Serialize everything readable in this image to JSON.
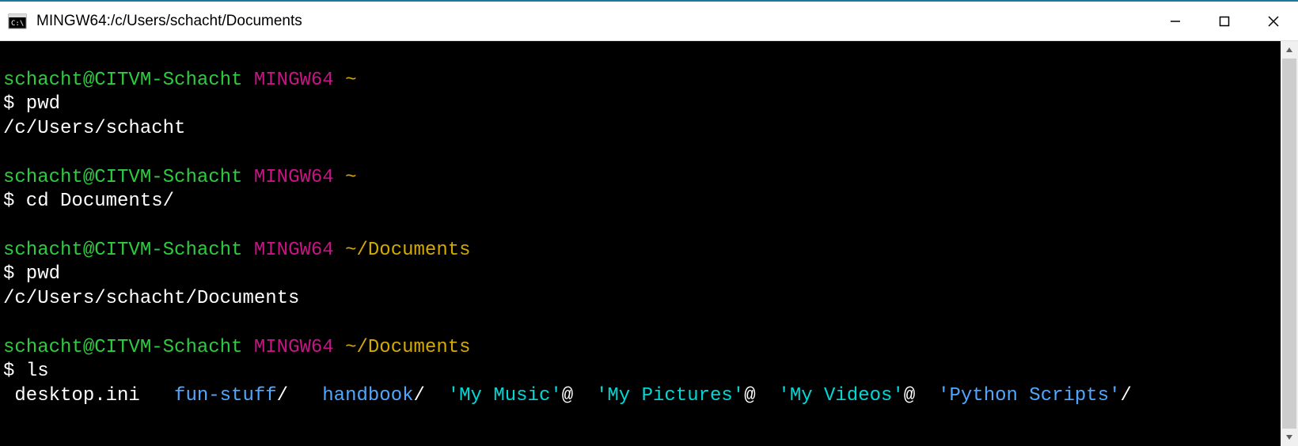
{
  "window": {
    "title": "MINGW64:/c/Users/schacht/Documents"
  },
  "terminal": {
    "blocks": [
      {
        "user_host": "schacht@CITVM-Schacht",
        "env": "MINGW64",
        "path": "~",
        "prompt": "$",
        "command": "pwd",
        "output": [
          {
            "segments": [
              {
                "text": "/c/Users/schacht",
                "cls": "white-txt"
              }
            ]
          }
        ]
      },
      {
        "user_host": "schacht@CITVM-Schacht",
        "env": "MINGW64",
        "path": "~",
        "prompt": "$",
        "command": "cd Documents/",
        "output": []
      },
      {
        "user_host": "schacht@CITVM-Schacht",
        "env": "MINGW64",
        "path": "~/Documents",
        "prompt": "$",
        "command": "pwd",
        "output": [
          {
            "segments": [
              {
                "text": "/c/Users/schacht/Documents",
                "cls": "white-txt"
              }
            ]
          }
        ]
      },
      {
        "user_host": "schacht@CITVM-Schacht",
        "env": "MINGW64",
        "path": "~/Documents",
        "prompt": "$",
        "command": "ls",
        "output": [
          {
            "segments": [
              {
                "text": " desktop.ini   ",
                "cls": "white-txt"
              },
              {
                "text": "fun-stuff",
                "cls": "blue-txt"
              },
              {
                "text": "/   ",
                "cls": "white-txt"
              },
              {
                "text": "handbook",
                "cls": "blue-txt"
              },
              {
                "text": "/  ",
                "cls": "white-txt"
              },
              {
                "text": "'My Music'",
                "cls": "cyan-txt"
              },
              {
                "text": "@  ",
                "cls": "white-txt"
              },
              {
                "text": "'My Pictures'",
                "cls": "cyan-txt"
              },
              {
                "text": "@  ",
                "cls": "white-txt"
              },
              {
                "text": "'My Videos'",
                "cls": "cyan-txt"
              },
              {
                "text": "@  ",
                "cls": "white-txt"
              },
              {
                "text": "'Python Scripts'",
                "cls": "blue-txt"
              },
              {
                "text": "/",
                "cls": "white-txt"
              }
            ]
          }
        ]
      }
    ]
  }
}
